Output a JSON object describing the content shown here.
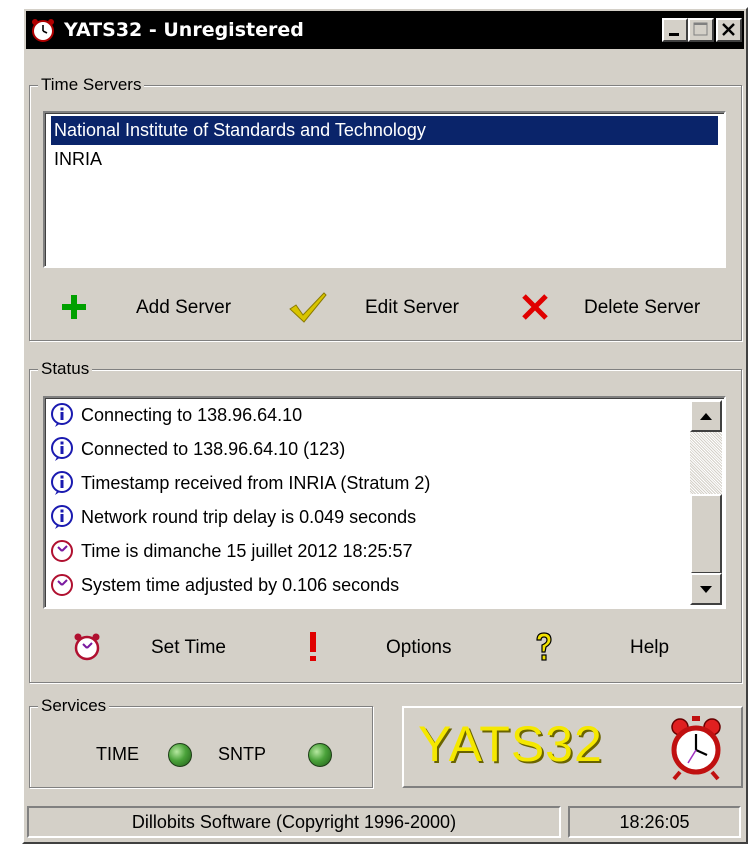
{
  "window": {
    "title": "YATS32 - Unregistered",
    "title_icon": "alarm-clock-icon"
  },
  "time_servers": {
    "legend": "Time Servers",
    "items": [
      {
        "label": "National Institute of Standards and Technology",
        "selected": true
      },
      {
        "label": "INRIA",
        "selected": false
      }
    ],
    "buttons": {
      "add": {
        "label": "Add Server",
        "icon": "plus-icon",
        "color": "#00a000"
      },
      "edit": {
        "label": "Edit Server",
        "icon": "checkmark-icon",
        "color": "#c8b400"
      },
      "delete": {
        "label": "Delete Server",
        "icon": "x-icon",
        "color": "#e00000"
      }
    }
  },
  "status": {
    "legend": "Status",
    "log": [
      {
        "icon": "info-icon",
        "text": "Connecting to 138.96.64.10"
      },
      {
        "icon": "info-icon",
        "text": "Connected to 138.96.64.10 (123)"
      },
      {
        "icon": "info-icon",
        "text": "Timestamp received from INRIA (Stratum 2)"
      },
      {
        "icon": "info-icon",
        "text": "Network round trip delay is 0.049 seconds"
      },
      {
        "icon": "clock-icon",
        "text": "Time is dimanche 15 juillet 2012 18:25:57"
      },
      {
        "icon": "clock-icon",
        "text": "System time adjusted by 0.106 seconds"
      }
    ],
    "buttons": {
      "set_time": {
        "label": "Set Time",
        "icon": "alarm-clock-icon"
      },
      "options": {
        "label": "Options",
        "icon": "exclamation-icon"
      },
      "help": {
        "label": "Help",
        "icon": "question-icon"
      }
    }
  },
  "services": {
    "legend": "Services",
    "items": [
      {
        "label": "TIME",
        "state": "on"
      },
      {
        "label": "SNTP",
        "state": "on"
      }
    ],
    "lamp_color": "#4aa23a"
  },
  "logo": {
    "text": "YATS32",
    "color": "#f5e800",
    "icon": "alarm-clock-icon"
  },
  "statusbar": {
    "copyright": "Dillobits Software (Copyright 1996-2000)",
    "time": "18:26:05"
  }
}
